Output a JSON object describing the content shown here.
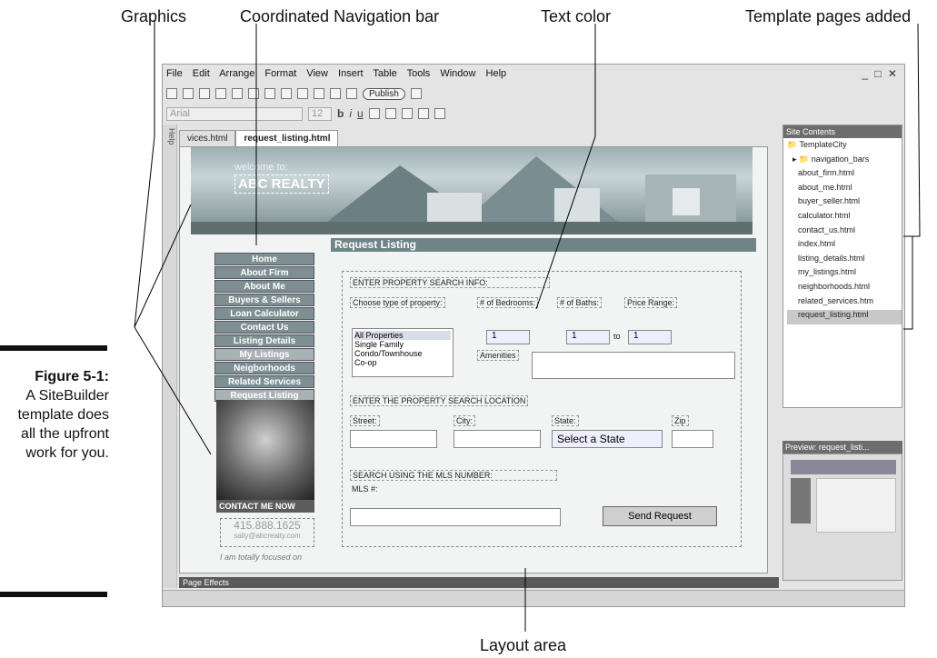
{
  "callouts": {
    "graphics": "Graphics",
    "nav_bar": "Coordinated Navigation bar",
    "text_color": "Text color",
    "template_pages": "Template pages added",
    "layout_area": "Layout area"
  },
  "caption": {
    "label": "Figure 5-1:",
    "text": "A SiteBuilder template does all the upfront work for you."
  },
  "menu": [
    "File",
    "Edit",
    "Arrange",
    "Format",
    "View",
    "Insert",
    "Table",
    "Tools",
    "Window",
    "Help"
  ],
  "window_controls": "_ □ ✕",
  "toolbar": {
    "publish": "Publish",
    "font": "Arial",
    "size": "12"
  },
  "help_label": "Help",
  "tabs": [
    "vices.html",
    "request_listing.html"
  ],
  "header": {
    "welcome": "welcome to:",
    "company": "ABC REALTY"
  },
  "nav_items": [
    "Home",
    "About Firm",
    "About Me",
    "Buyers & Sellers",
    "Loan Calculator",
    "Contact Us",
    "Listing Details",
    "My Listings",
    "Neigborhoods",
    "Related Services",
    "Request Listing"
  ],
  "contact_now": "CONTACT ME NOW",
  "phone": "415.888.1625",
  "email": "sally@abcrealty.com",
  "tagline": "I am totally focused on",
  "form": {
    "title": "Request Listing",
    "section1": "ENTER PROPERTY SEARCH INFO:",
    "type_label": "Choose type of property:",
    "bed_label": "# of Bedrooms:",
    "bath_label": "# of Baths:",
    "price_label": "Price Range:",
    "property_types": [
      "All Properties",
      "Single Family",
      "Condo/Townhouse",
      "Co-op"
    ],
    "bed_value": "1",
    "bath_value": "1",
    "bath_to": "to",
    "bath_value2": "1",
    "amenities": "Amenities",
    "section2": "ENTER THE PROPERTY SEARCH LOCATION",
    "street": "Street:",
    "city": "City:",
    "state": "State:",
    "zip": "Zip",
    "state_select": "Select a State",
    "section3": "SEARCH USING THE MLS NUMBER:",
    "mls": "MLS #:",
    "send": "Send Request"
  },
  "site_contents": {
    "title": "Site Contents",
    "root": "TemplateCity",
    "folder": "navigation_bars",
    "files": [
      "about_firm.html",
      "about_me.html",
      "buyer_seller.html",
      "calculator.html",
      "contact_us.html",
      "index.html",
      "listing_details.html",
      "my_listings.html",
      "neighborhoods.html",
      "related_services.htm",
      "request_listing.html"
    ]
  },
  "preview_title": "Preview: request_listi...",
  "page_effects": "Page Effects"
}
